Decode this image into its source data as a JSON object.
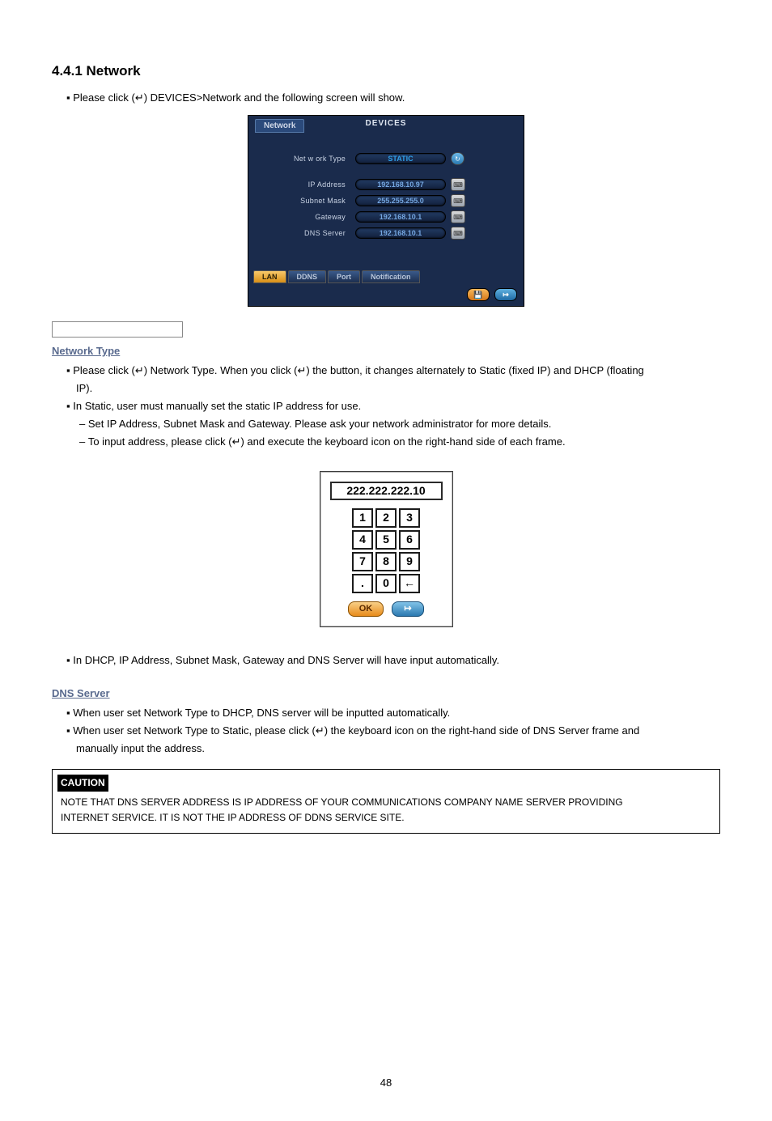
{
  "heading": "4.4.1  Network",
  "intro": "Please click (↵) DEVICES>Network and the following screen will show.",
  "fig1": {
    "top_tab": "Network",
    "title": "DEVICES",
    "rows": {
      "net_type_label": "Net w ork Type",
      "net_type_value": "STATIC",
      "ip_label": "IP Address",
      "ip_value": "192.168.10.97",
      "subnet_label": "Subnet Mask",
      "subnet_value": "255.255.255.0",
      "gateway_label": "Gateway",
      "gateway_value": "192.168.10.1",
      "dns_label": "DNS Server",
      "dns_value": "192.168.10.1"
    },
    "tabs": {
      "lan": "LAN",
      "ddns": "DDNS",
      "port": "Port",
      "notification": "Notification"
    },
    "footer_save": "💾",
    "footer_exit": "↦"
  },
  "nt_heading": "Network Type",
  "nt_b1_a": "Please click (↵) Network Type. When you click (↵) the button, it changes alternately to Static (fixed IP) and DHCP (floating",
  "nt_b1_b": "IP).",
  "nt_b2": "In Static, user must manually set the static IP address for use.",
  "nt_d1": "Set IP Address, Subnet Mask and Gateway. Please ask your network administrator for more details.",
  "nt_d2": "To input address, please click (↵) and execute the keyboard icon on the right-hand side of each frame.",
  "keypad": {
    "display": "222.222.222.10",
    "keys": {
      "k1": "1",
      "k2": "2",
      "k3": "3",
      "k4": "4",
      "k5": "5",
      "k6": "6",
      "k7": "7",
      "k8": "8",
      "k9": "9",
      "dot": ".",
      "k0": "0",
      "back": "←"
    },
    "ok": "OK",
    "exit": "↦"
  },
  "nt_b3": "In DHCP, IP Address, Subnet Mask, Gateway and DNS Server will have input automatically.",
  "dns_heading": "DNS Server",
  "dns_b1": "When user set Network Type to DHCP, DNS server will be inputted automatically.",
  "dns_b2_a": "When user set Network Type to Static, please click (↵) the keyboard icon on the right-hand side of DNS Server frame and",
  "dns_b2_b": "manually input the address.",
  "caution_label": "CAUTION",
  "caution_l1": "NOTE THAT DNS SERVER ADDRESS IS IP ADDRESS OF YOUR COMMUNICATIONS COMPANY NAME SERVER PROVIDING",
  "caution_l2": "INTERNET SERVICE. IT IS NOT THE IP ADDRESS OF DDNS SERVICE SITE.",
  "page_number": "48"
}
